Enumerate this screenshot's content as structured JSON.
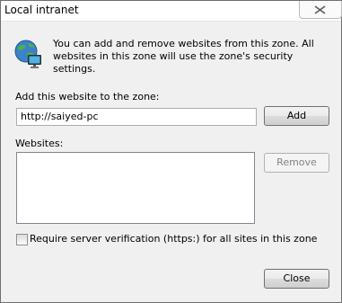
{
  "window": {
    "title": "Local intranet"
  },
  "description": "You can add and remove websites from this zone. All websites in this zone will use the zone's security settings.",
  "add_section": {
    "label": "Add this website to the zone:",
    "url_value": "http://saiyed-pc",
    "add_button": "Add"
  },
  "websites": {
    "label": "Websites:",
    "items": [],
    "remove_button": "Remove"
  },
  "require_verification": {
    "label": "Require server verification (https:) for all sites in this zone",
    "checked": false
  },
  "close_button": "Close",
  "icons": {
    "zone": "globe-network-icon",
    "close": "close-x-icon"
  },
  "colors": {
    "dialog_bg": "#f0f0f0",
    "border": "#6f6f6f"
  }
}
